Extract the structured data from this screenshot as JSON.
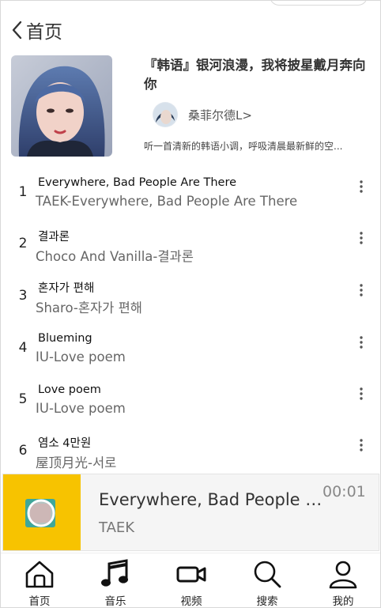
{
  "header": {
    "title": "首页",
    "back_icon": "chevron-left-icon"
  },
  "playlist": {
    "title": "『韩语』银河浪漫，我将披星戴月奔向你",
    "creator": "桑菲尔德L>",
    "description": "听一首清新的韩语小调，呼吸清晨最新鲜的空..."
  },
  "songs": [
    {
      "index": "1",
      "name": "Everywhere, Bad People Are There",
      "sub": "TAEK-Everywhere, Bad People Are There"
    },
    {
      "index": "2",
      "name": "결과론",
      "sub": "Choco And Vanilla-결과론"
    },
    {
      "index": "3",
      "name": "혼자가 편해",
      "sub": "Sharo-혼자가 편해"
    },
    {
      "index": "4",
      "name": "Blueming",
      "sub": "IU-Love poem"
    },
    {
      "index": "5",
      "name": "Love poem",
      "sub": "IU-Love poem"
    },
    {
      "index": "6",
      "name": "염소 4만원",
      "sub": "屋顶月光-서로"
    }
  ],
  "player": {
    "title": "Everywhere, Bad People Are There",
    "artist": "TAEK",
    "time": "00:01",
    "cover_color": "#f7c300"
  },
  "tabs": [
    {
      "label": "首页",
      "icon": "home-icon"
    },
    {
      "label": "音乐",
      "icon": "music-note-icon"
    },
    {
      "label": "视频",
      "icon": "video-camera-icon"
    },
    {
      "label": "搜索",
      "icon": "search-icon"
    },
    {
      "label": "我的",
      "icon": "user-icon"
    }
  ]
}
